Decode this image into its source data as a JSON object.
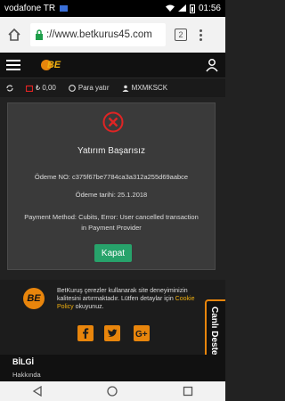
{
  "status_bar": {
    "carrier": "vodafone TR",
    "time": "01:56"
  },
  "browser": {
    "url": "://www.betkurus45.com",
    "tab_count": "2"
  },
  "info_bar": {
    "balance": "₺ 0,00",
    "deposit_label": "Para yatır",
    "username": "MXMKSCK"
  },
  "dialog": {
    "title": "Yatırım Başarısız",
    "payment_no": "Ödeme NO: c375f67be7784ca3a312a255d69aabce",
    "payment_date": "Ödeme tarihi: 25.1.2018",
    "error_line1": "Payment Method: Cubits, Error: User cancelled transaction",
    "error_line2": "in Payment Provider",
    "close_label": "Kapat"
  },
  "cookie": {
    "text_before": "BetKuruş çerezler kullanarak site deneyiminizin kalitesini artırmaktadır. Lütfen detaylar için ",
    "link": "Cookie Policy",
    "text_after": " okuyunuz."
  },
  "live_support": "Canlı Destek",
  "footer": {
    "title": "BİLGİ",
    "subtitle": "Hakkında"
  },
  "colors": {
    "accent": "#e8850c",
    "button_green": "#27a36b",
    "error_red": "#e02424"
  }
}
